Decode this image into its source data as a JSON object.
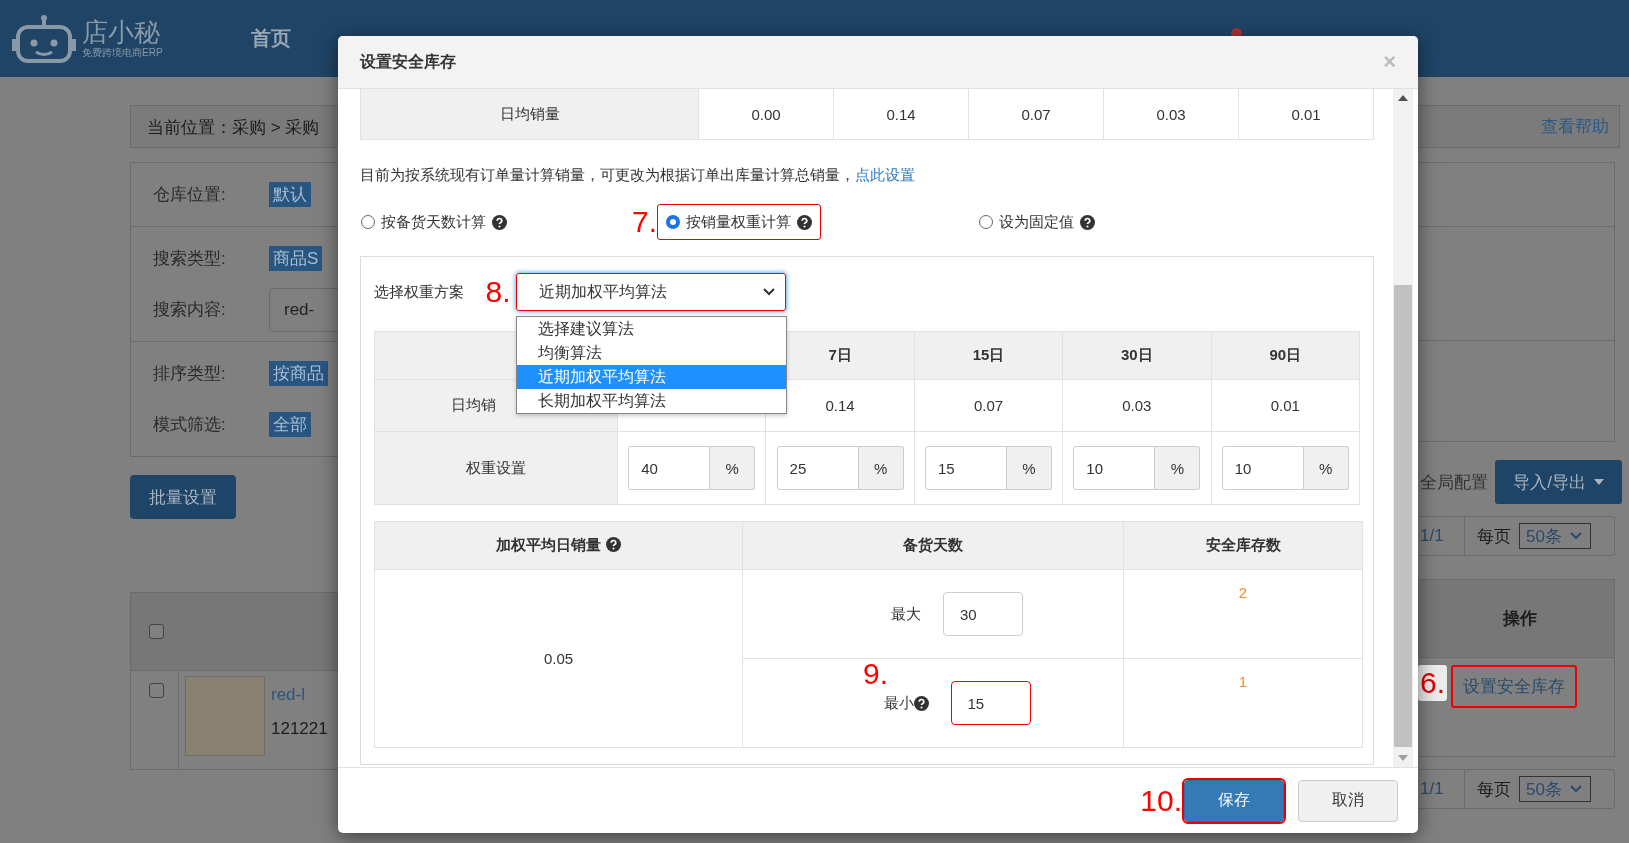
{
  "header": {
    "logo": "店小秘",
    "logo_tagline": "免费跨境电商ERP",
    "nav": [
      "首页"
    ]
  },
  "page": {
    "breadcrumb": "当前位置：采购 > 采购",
    "help_link": "查看帮助",
    "filter_groups": [
      [
        {
          "label": "仓库位置:",
          "value": "默认",
          "kind": "tag"
        }
      ],
      [
        {
          "label": "搜索类型:",
          "value": "商品S",
          "kind": "tag"
        },
        {
          "label": "搜索内容:",
          "value": "red-",
          "kind": "input"
        }
      ],
      [
        {
          "label": "排序类型:",
          "value": "按商品",
          "kind": "tag"
        },
        {
          "label": "模式筛选:",
          "value": "全部",
          "kind": "tag"
        }
      ]
    ],
    "batch_button": "批量设置",
    "global_config": "全局配置",
    "export_button": "导入/导出",
    "pagination_top": {
      "pages": "1/1",
      "per_page_label": "每页",
      "per_page": "50条"
    },
    "pagination_bottom": {
      "pages": "1/1",
      "per_page_label": "每页",
      "per_page": "50条"
    },
    "table": {
      "action_header": "操作",
      "all_checked": false,
      "rows": [
        {
          "checked": false,
          "name": "red-l",
          "sku": "121221",
          "action": "设置安全库存",
          "highlighted": true,
          "step": "6."
        }
      ]
    }
  },
  "dialog": {
    "title": "设置安全库存",
    "close": "×",
    "top_table": {
      "label": "日均销量",
      "values": [
        "0.00",
        "0.14",
        "0.07",
        "0.03",
        "0.01"
      ]
    },
    "note": "目前为按系统现有订单量计算销量，可更改为根据订单出库量计算总销量，",
    "note_link": "点此设置",
    "methods": [
      {
        "label": "按备货天数计算",
        "selected": false,
        "highlighted": false
      },
      {
        "label": "按销量权重计算",
        "selected": true,
        "highlighted": true,
        "step": "7."
      },
      {
        "label": "设为固定值",
        "selected": false,
        "highlighted": false
      }
    ],
    "scheme": {
      "label": "选择权重方案",
      "step": "8.",
      "value": "近期加权平均算法",
      "highlighted": true,
      "expanded": true,
      "options": [
        {
          "label": "选择建议算法",
          "selected": false
        },
        {
          "label": "均衡算法",
          "selected": false
        },
        {
          "label": "近期加权平均算法",
          "selected": true
        },
        {
          "label": "长期加权平均算法",
          "selected": false
        }
      ]
    },
    "weight_table": {
      "columns": [
        "7日",
        "15日",
        "30日",
        "90日"
      ],
      "daily_label": "日均销",
      "daily_values": [
        "0.14",
        "0.07",
        "0.03",
        "0.01"
      ],
      "weight_label": "权重设置",
      "weights": [
        {
          "value": "40",
          "unit": "%"
        },
        {
          "value": "25",
          "unit": "%"
        },
        {
          "value": "15",
          "unit": "%"
        },
        {
          "value": "10",
          "unit": "%"
        },
        {
          "value": "10",
          "unit": "%"
        }
      ]
    },
    "result_table": {
      "columns": [
        "加权平均日销量",
        "备货天数",
        "安全库存数"
      ],
      "average": "0.05",
      "rows": [
        {
          "label": "最大",
          "help": false,
          "value": "30",
          "safety": "2",
          "highlighted": false
        },
        {
          "label": "最小",
          "help": true,
          "value": "15",
          "safety": "1",
          "highlighted": true,
          "step": "9."
        }
      ]
    },
    "buttons": [
      {
        "label": "保存",
        "kind": "primary",
        "highlighted": true,
        "step": "10."
      },
      {
        "label": "取消",
        "kind": "default",
        "highlighted": false
      }
    ]
  }
}
